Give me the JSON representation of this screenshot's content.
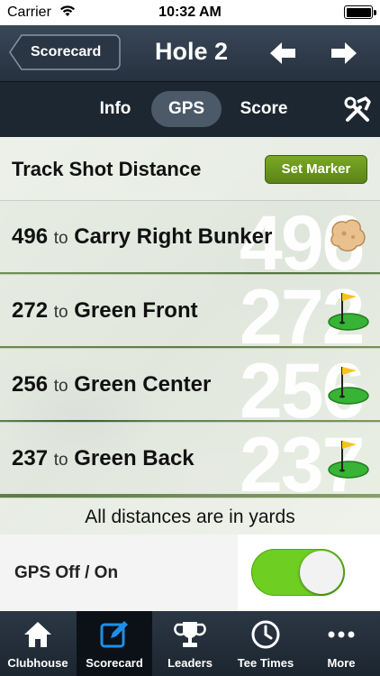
{
  "status_bar": {
    "carrier": "Carrier",
    "time": "10:32 AM"
  },
  "nav": {
    "back_label": "Scorecard",
    "title": "Hole 2"
  },
  "segments": {
    "info": "Info",
    "gps": "GPS",
    "score": "Score",
    "selected": "GPS"
  },
  "track": {
    "label": "Track Shot Distance",
    "button": "Set Marker"
  },
  "distances": [
    {
      "yards": "496",
      "to": "to",
      "target": "Carry Right Bunker",
      "icon": "bunker-icon"
    },
    {
      "yards": "272",
      "to": "to",
      "target": "Green Front",
      "icon": "green-flag-icon"
    },
    {
      "yards": "256",
      "to": "to",
      "target": "Green Center",
      "icon": "green-flag-icon"
    },
    {
      "yards": "237",
      "to": "to",
      "target": "Green Back",
      "icon": "green-flag-icon"
    }
  ],
  "note": "All distances are in yards",
  "gps_toggle": {
    "label": "GPS Off / On",
    "on": true
  },
  "tabbar": {
    "items": [
      {
        "label": "Clubhouse",
        "icon": "house-icon"
      },
      {
        "label": "Scorecard",
        "icon": "edit-icon"
      },
      {
        "label": "Leaders",
        "icon": "trophy-icon"
      },
      {
        "label": "Tee Times",
        "icon": "clock-icon"
      },
      {
        "label": "More",
        "icon": "more-dots-icon"
      }
    ],
    "selected": "Scorecard"
  },
  "colors": {
    "nav": "#2f3b4a",
    "accent_green": "#6fce22",
    "button_green": "#6a9a1e",
    "flag": "#f7c21e"
  }
}
